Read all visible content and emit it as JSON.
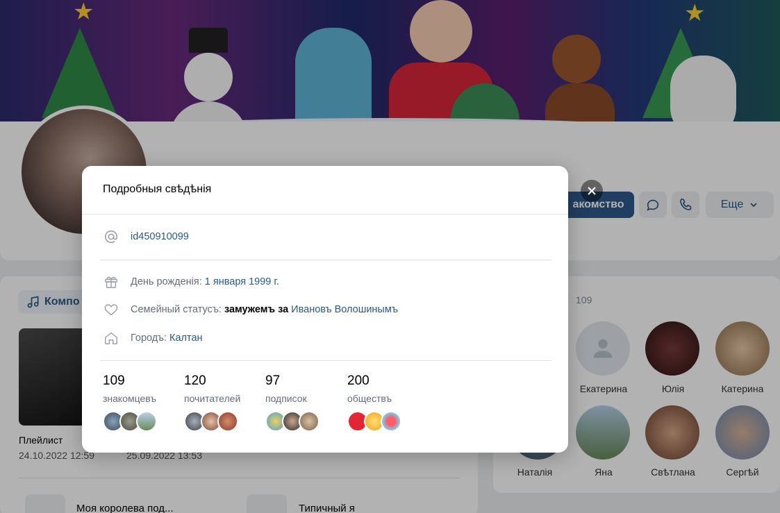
{
  "background": {
    "profile_button_partial": "акомство",
    "more_button": "Еще",
    "music_tab_partial": "Компо",
    "playlists": [
      {
        "title": "Плейлист",
        "date": "24.10.2022 12:59"
      },
      {
        "title": "",
        "date": "25.09.2022 13:53"
      }
    ],
    "tracks": [
      {
        "title": "Моя королева под..."
      },
      {
        "title": "Типичный я"
      }
    ],
    "friends_count_partial": "109",
    "friends": [
      {
        "name": "Екатерина"
      },
      {
        "name": "Юлія"
      },
      {
        "name": "Катерина"
      },
      {
        "name": "Наталія"
      },
      {
        "name": "Яна"
      },
      {
        "name": "Свѣтлана"
      },
      {
        "name": "Сергѣй"
      }
    ]
  },
  "modal": {
    "title": "Подробныя свѣдѣнія",
    "user_id": "id450910099",
    "birthday": {
      "label": "День рожденія:",
      "value": "1 января 1999 г."
    },
    "family": {
      "label": "Семейный статусъ:",
      "status": "замужемъ за",
      "partner": "Ивановъ Волошинымъ"
    },
    "city": {
      "label": "Городъ:",
      "value": "Калтан"
    },
    "stats": [
      {
        "number": "109",
        "caption": "знакомцевъ"
      },
      {
        "number": "120",
        "caption": "почитателей"
      },
      {
        "number": "97",
        "caption": "подписок"
      },
      {
        "number": "200",
        "caption": "обществъ"
      }
    ],
    "close_label": "×"
  },
  "colors": {
    "accent": "#2a5885",
    "button_blue": "#2e5a8c",
    "overlay": "rgba(0,0,0,0.30)"
  },
  "icons": [
    "at-icon",
    "gift-icon",
    "heart-icon",
    "home-icon",
    "close-icon",
    "message-icon",
    "phone-icon",
    "chevron-down-icon",
    "music-note-icon",
    "user-placeholder-icon"
  ]
}
